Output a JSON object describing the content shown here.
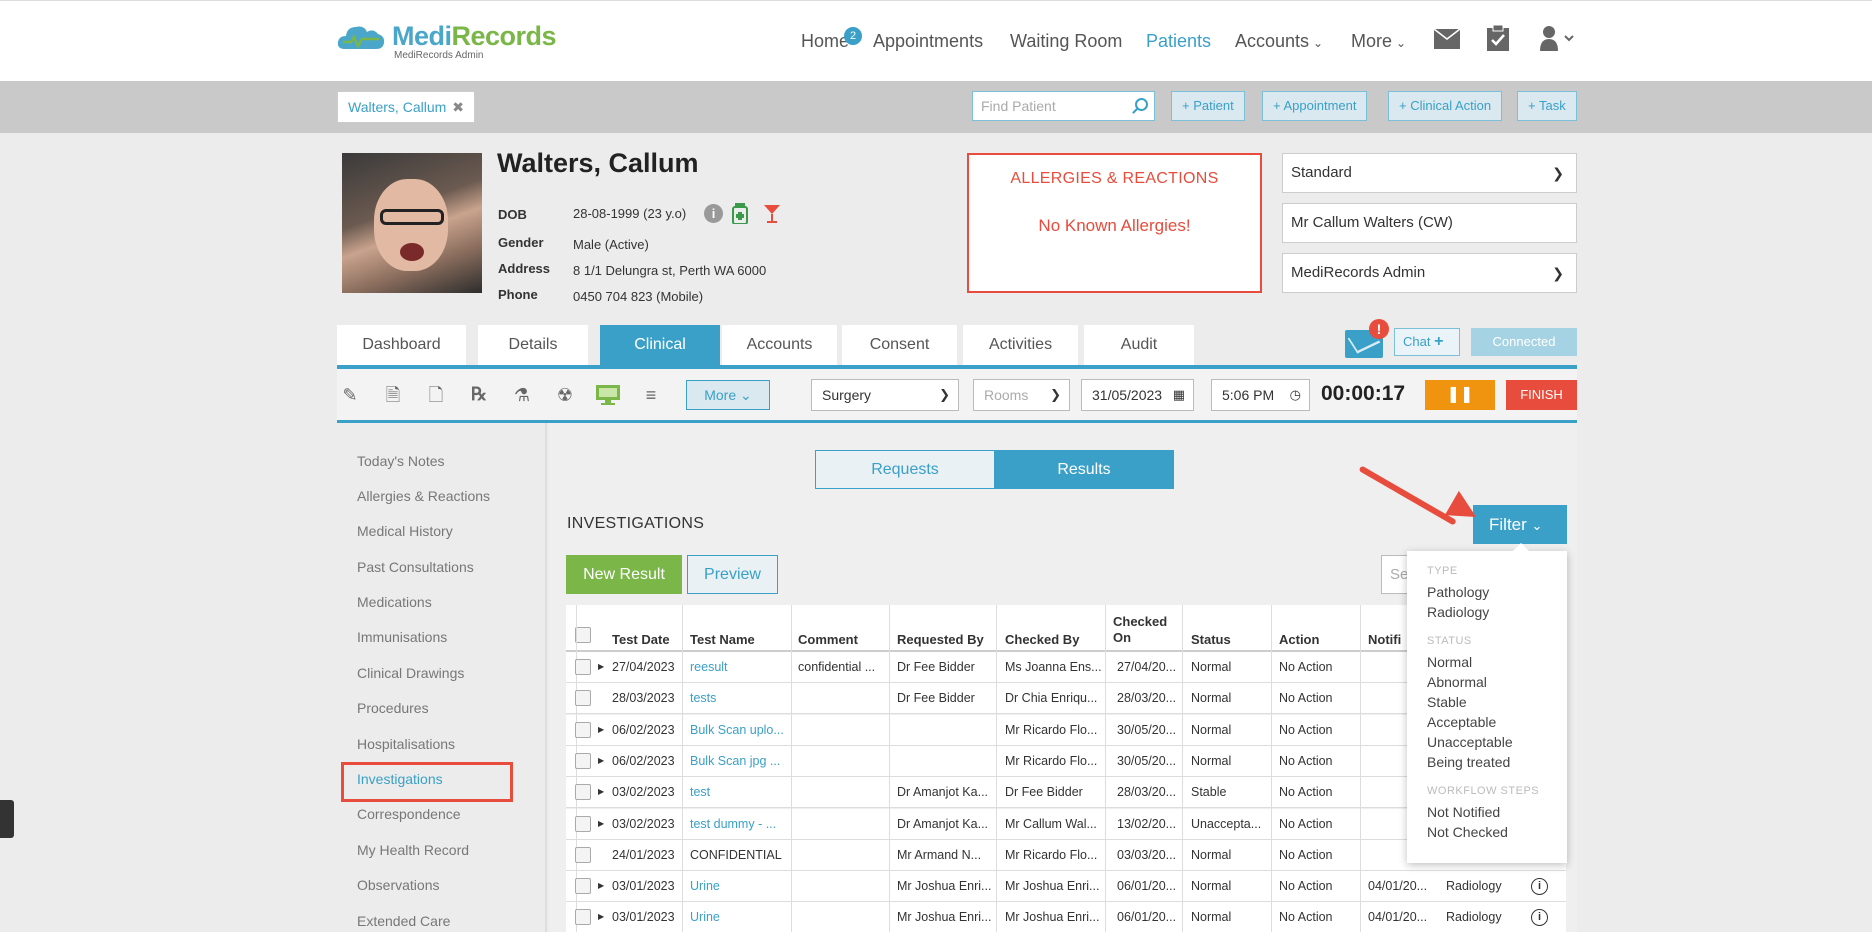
{
  "brand": {
    "name_a": "Medi",
    "name_b": "Records",
    "subtitle": "MediRecords Admin"
  },
  "nav": {
    "home": "Home",
    "home_badge": "2",
    "appointments": "Appointments",
    "waiting_room": "Waiting Room",
    "patients": "Patients",
    "accounts": "Accounts",
    "more": "More"
  },
  "subbar": {
    "patient_tab": "Walters, Callum",
    "find_placeholder": "Find Patient",
    "add_patient": "+ Patient",
    "add_appointment": "+ Appointment",
    "add_clinical_action": "+ Clinical Action",
    "add_task": "+ Task"
  },
  "patient": {
    "name": "Walters, Callum",
    "dob_label": "DOB",
    "dob": "28-08-1999 (23 y.o)",
    "gender_label": "Gender",
    "gender": "Male (Active)",
    "address_label": "Address",
    "address": "8 1/1 Delungra st, Perth WA 6000",
    "phone_label": "Phone",
    "phone": "0450 704 823 (Mobile)"
  },
  "allergies": {
    "title": "ALLERGIES & REACTIONS",
    "status": "No Known Allergies!"
  },
  "right_selects": {
    "template": "Standard",
    "patient_ref": "Mr Callum Walters (CW)",
    "practice": "MediRecords Admin"
  },
  "tabs": [
    "Dashboard",
    "Details",
    "Clinical",
    "Accounts",
    "Consent",
    "Activities",
    "Audit"
  ],
  "comm": {
    "alert": "!",
    "chat": "Chat",
    "connected": "Connected"
  },
  "toolbar": {
    "more": "More",
    "location": "Surgery",
    "rooms": "Rooms",
    "date": "31/05/2023",
    "time": "5:06 PM",
    "timer": "00:00:17",
    "finish": "FINISH"
  },
  "sidebar": [
    "Today's Notes",
    "Allergies & Reactions",
    "Medical History",
    "Past Consultations",
    "Medications",
    "Immunisations",
    "Clinical Drawings",
    "Procedures",
    "Hospitalisations",
    "Investigations",
    "Correspondence",
    "My Health Record",
    "Observations",
    "Extended Care"
  ],
  "main": {
    "seg_requests": "Requests",
    "seg_results": "Results",
    "title": "INVESTIGATIONS",
    "new_result": "New Result",
    "preview": "Preview",
    "search_placeholder": "Se",
    "filter": "Filter"
  },
  "table": {
    "headers": [
      "Test Date",
      "Test Name",
      "Comment",
      "Requested By",
      "Checked By",
      "Checked On",
      "Status",
      "Action",
      "Notifi"
    ],
    "rows": [
      {
        "date": "27/04/2023",
        "name": "reesult",
        "link": true,
        "comment": "confidential ...",
        "req": "Dr Fee Bidder",
        "chk": "Ms Joanna Ens...",
        "on": "27/04/20...",
        "status": "Normal",
        "action": "No Action",
        "notif": "",
        "type": "",
        "arrow": true
      },
      {
        "date": "28/03/2023",
        "name": "tests",
        "link": true,
        "comment": "",
        "req": "Dr Fee Bidder",
        "chk": "Dr Chia Enriqu...",
        "on": "28/03/20...",
        "status": "Normal",
        "action": "No Action",
        "notif": "",
        "type": "",
        "arrow": false
      },
      {
        "date": "06/02/2023",
        "name": "Bulk Scan uplo...",
        "link": true,
        "comment": "",
        "req": "",
        "chk": "Mr Ricardo Flo...",
        "on": "30/05/20...",
        "status": "Normal",
        "action": "No Action",
        "notif": "",
        "type": "",
        "arrow": true
      },
      {
        "date": "06/02/2023",
        "name": "Bulk Scan jpg ...",
        "link": true,
        "comment": "",
        "req": "",
        "chk": "Mr Ricardo Flo...",
        "on": "30/05/20...",
        "status": "Normal",
        "action": "No Action",
        "notif": "",
        "type": "",
        "arrow": true
      },
      {
        "date": "03/02/2023",
        "name": "test",
        "link": true,
        "comment": "",
        "req": "Dr Amanjot Ka...",
        "chk": "Dr Fee Bidder",
        "on": "28/03/20...",
        "status": "Stable",
        "action": "No Action",
        "notif": "",
        "type": "",
        "arrow": true
      },
      {
        "date": "03/02/2023",
        "name": "test dummy - ...",
        "link": true,
        "comment": "",
        "req": "Dr Amanjot Ka...",
        "chk": "Mr Callum Wal...",
        "on": "13/02/20...",
        "status": "Unaccepta...",
        "action": "No Action",
        "notif": "",
        "type": "",
        "arrow": true
      },
      {
        "date": "24/01/2023",
        "name": "CONFIDENTIAL",
        "link": false,
        "comment": "",
        "req": "Mr Armand N...",
        "chk": "Mr Ricardo Flo...",
        "on": "03/03/20...",
        "status": "Normal",
        "action": "No Action",
        "notif": "",
        "type": "",
        "arrow": false
      },
      {
        "date": "03/01/2023",
        "name": "Urine",
        "link": true,
        "comment": "",
        "req": "Mr Joshua Enri...",
        "chk": "Mr Joshua Enri...",
        "on": "06/01/20...",
        "status": "Normal",
        "action": "No Action",
        "notif": "04/01/20...",
        "type": "Radiology",
        "arrow": true
      },
      {
        "date": "03/01/2023",
        "name": "Urine",
        "link": true,
        "comment": "",
        "req": "Mr Joshua Enri...",
        "chk": "Mr Joshua Enri...",
        "on": "06/01/20...",
        "status": "Normal",
        "action": "No Action",
        "notif": "04/01/20...",
        "type": "Radiology",
        "arrow": true
      }
    ]
  },
  "filter_menu": {
    "type_heading": "TYPE",
    "types": [
      "Pathology",
      "Radiology"
    ],
    "status_heading": "STATUS",
    "statuses": [
      "Normal",
      "Abnormal",
      "Stable",
      "Acceptable",
      "Unacceptable",
      "Being treated"
    ],
    "workflow_heading": "WORKFLOW STEPS",
    "workflow": [
      "Not Notified",
      "Not Checked"
    ]
  },
  "colors": {
    "accent": "#3aa0c8",
    "green": "#7ab648",
    "alert": "#e74c3c",
    "orange": "#f0930e"
  }
}
